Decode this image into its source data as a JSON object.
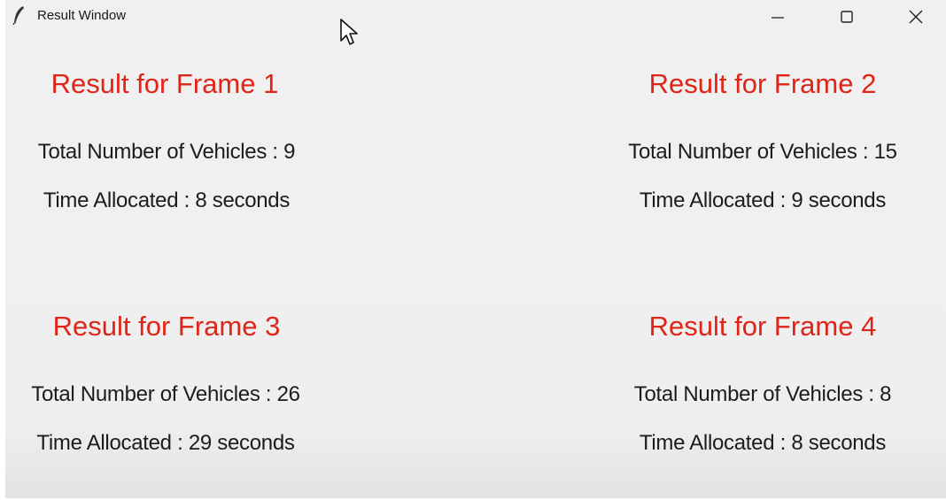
{
  "window": {
    "title": "Result Window",
    "icon": "feather-icon",
    "controls": [
      "minimize-icon",
      "maximize-icon",
      "close-icon"
    ]
  },
  "labels": {
    "total_prefix": "Total Number of Vehicles : ",
    "time_prefix": "Time Allocated : ",
    "time_suffix": " seconds"
  },
  "frames": [
    {
      "title": "Result for Frame 1",
      "vehicles_text": "Total Number of Vehicles : 9",
      "time_text": "Time Allocated : 8 seconds",
      "vehicles": 9,
      "seconds": 8
    },
    {
      "title": "Result for Frame 2",
      "vehicles_text": "Total Number of Vehicles : 15",
      "time_text": "Time Allocated : 9 seconds",
      "vehicles": 15,
      "seconds": 9
    },
    {
      "title": "Result for Frame 3",
      "vehicles_text": "Total Number of Vehicles : 26",
      "time_text": "Time Allocated : 29 seconds",
      "vehicles": 26,
      "seconds": 29
    },
    {
      "title": "Result for Frame 4",
      "vehicles_text": "Total Number of Vehicles : 8",
      "time_text": "Time Allocated : 8 seconds",
      "vehicles": 8,
      "seconds": 8
    }
  ],
  "colors": {
    "heading": "#e02418",
    "text": "#1c1c1c",
    "background": "#f0f0f0"
  }
}
